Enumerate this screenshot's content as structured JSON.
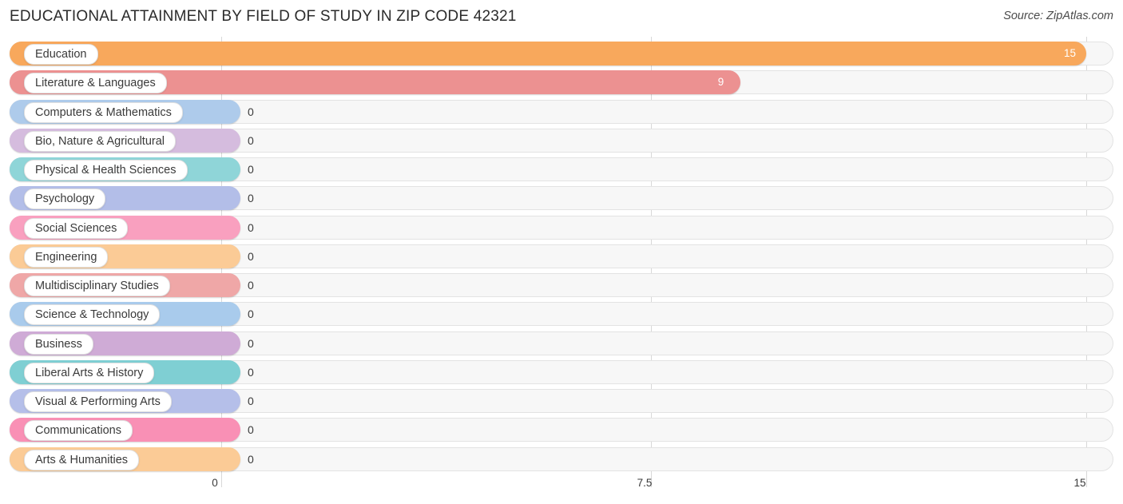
{
  "header": {
    "title": "EDUCATIONAL ATTAINMENT BY FIELD OF STUDY IN ZIP CODE 42321",
    "source": "Source: ZipAtlas.com"
  },
  "chart_data": {
    "type": "bar",
    "orientation": "horizontal",
    "title": "EDUCATIONAL ATTAINMENT BY FIELD OF STUDY IN ZIP CODE 42321",
    "xlabel": "",
    "ylabel": "",
    "xlim": [
      0,
      15
    ],
    "ticks": [
      "0",
      "7.5",
      "15"
    ],
    "tick_values": [
      0,
      7.5,
      15
    ],
    "grid": true,
    "legend": false,
    "categories": [
      "Education",
      "Literature & Languages",
      "Computers & Mathematics",
      "Bio, Nature & Agricultural",
      "Physical & Health Sciences",
      "Psychology",
      "Social Sciences",
      "Engineering",
      "Multidisciplinary Studies",
      "Science & Technology",
      "Business",
      "Liberal Arts & History",
      "Visual & Performing Arts",
      "Communications",
      "Arts & Humanities"
    ],
    "values": [
      15,
      9,
      0,
      0,
      0,
      0,
      0,
      0,
      0,
      0,
      0,
      0,
      0,
      0,
      0
    ],
    "value_labels": [
      "15",
      "9",
      "0",
      "0",
      "0",
      "0",
      "0",
      "0",
      "0",
      "0",
      "0",
      "0",
      "0",
      "0",
      "0"
    ],
    "colors": [
      "#F8A85C",
      "#EC9191",
      "#AECBEB",
      "#D5BCDE",
      "#8FD5D8",
      "#B3BEE8",
      "#F9A0BF",
      "#FBCB96",
      "#EFA7A7",
      "#A9CBEC",
      "#CFABD6",
      "#7FCFD3",
      "#B5BFE9",
      "#F990B5",
      "#FBCB96"
    ]
  },
  "axis": {
    "ticks": [
      {
        "label": "0",
        "x": 277
      },
      {
        "label": "7.5",
        "x": 815
      },
      {
        "label": "15",
        "x": 1360
      }
    ]
  }
}
